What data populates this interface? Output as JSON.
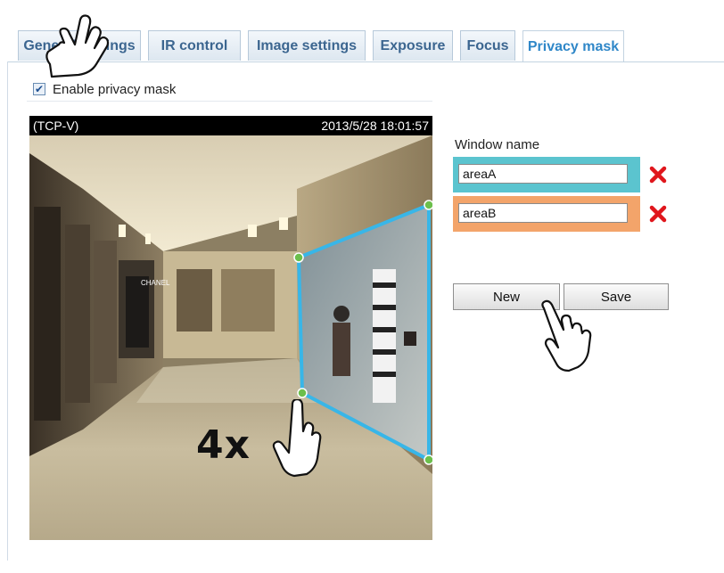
{
  "tabs": [
    {
      "label": "General settings"
    },
    {
      "label": "IR control"
    },
    {
      "label": "Image settings"
    },
    {
      "label": "Exposure"
    },
    {
      "label": "Focus"
    },
    {
      "label": "Privacy mask",
      "active": true
    }
  ],
  "enable": {
    "label": "Enable privacy mask",
    "checked": true
  },
  "video": {
    "source": "(TCP-V)",
    "timestamp": "2013/5/28 18:01:57",
    "sign_text": "CHANEL"
  },
  "windows": {
    "label": "Window name",
    "areas": [
      {
        "name": "areaA",
        "color": "#5bc4cf"
      },
      {
        "name": "areaB",
        "color": "#f3a46a"
      }
    ]
  },
  "buttons": {
    "new_label": "New",
    "save_label": "Save"
  },
  "annotation": {
    "count": "4x"
  },
  "colors": {
    "tab_text": "#3c6690",
    "tab_active_text": "#2f87c8",
    "mask_outline": "#38b6e8",
    "delete_icon": "#e0161c"
  }
}
